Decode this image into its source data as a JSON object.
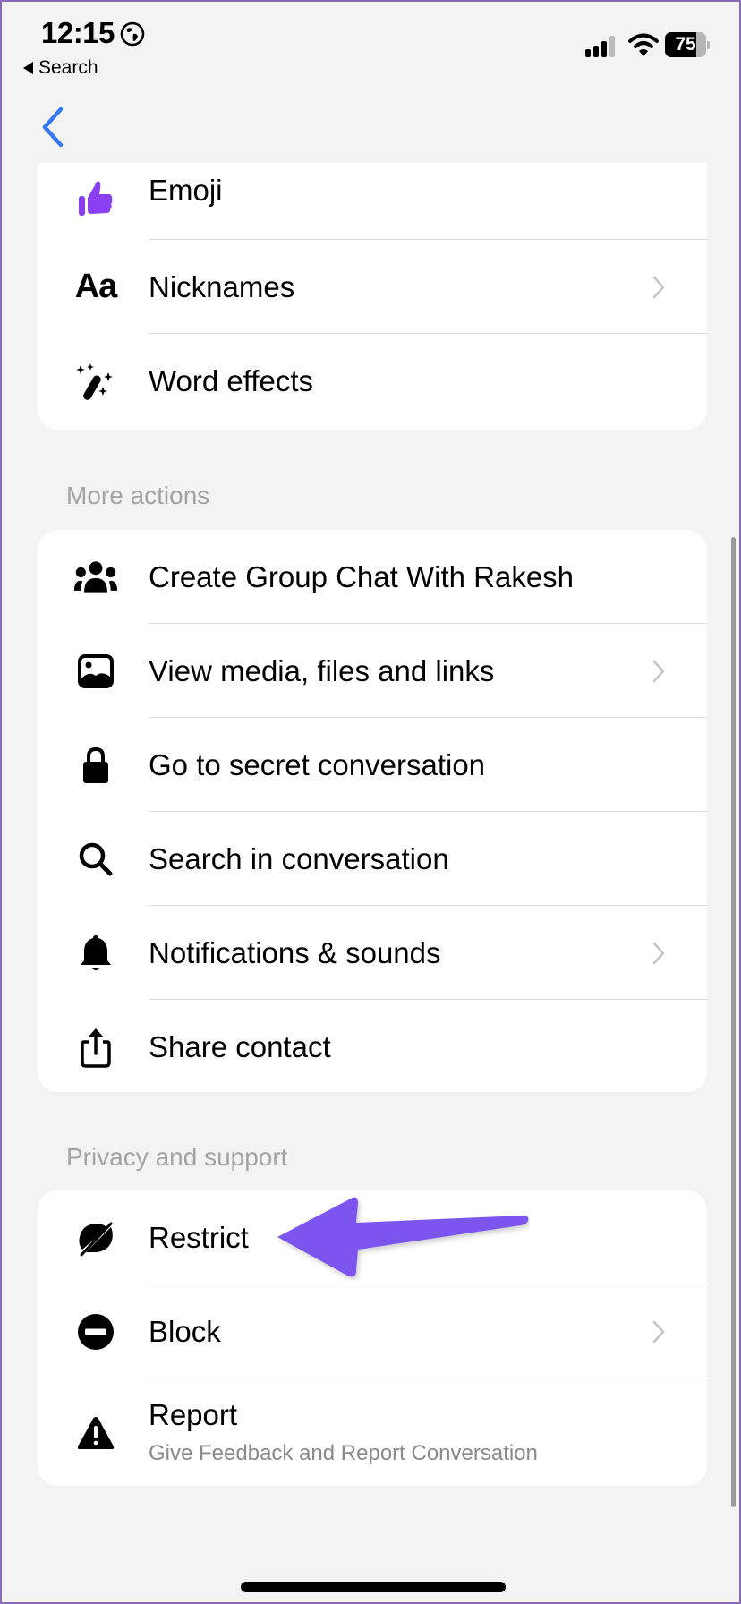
{
  "status_bar": {
    "time": "12:15",
    "back_app_label": "Search",
    "battery_percent": 75,
    "battery_label": "75",
    "signal_bars": 3,
    "icons": [
      "globe-icon",
      "signal-icon",
      "wifi-icon",
      "battery-icon"
    ]
  },
  "navigation": {
    "back_icon": "chevron-left-icon",
    "back_color": "#3478f6"
  },
  "customization_card": {
    "items": [
      {
        "label": "Emoji",
        "icon": "thumbs-up-icon",
        "icon_color": "#8a3ff2",
        "has_chevron": false
      },
      {
        "label": "Nicknames",
        "icon": "text-aa-icon",
        "has_chevron": true
      },
      {
        "label": "Word effects",
        "icon": "magic-wand-icon",
        "has_chevron": false
      }
    ]
  },
  "more_actions": {
    "title": "More actions",
    "items": [
      {
        "label": "Create Group Chat With Rakesh",
        "icon": "group-icon",
        "has_chevron": false
      },
      {
        "label": "View media, files and links",
        "icon": "image-icon",
        "has_chevron": true
      },
      {
        "label": "Go to secret conversation",
        "icon": "lock-icon",
        "has_chevron": false
      },
      {
        "label": "Search in conversation",
        "icon": "search-icon",
        "has_chevron": false
      },
      {
        "label": "Notifications & sounds",
        "icon": "bell-icon",
        "has_chevron": true
      },
      {
        "label": "Share contact",
        "icon": "share-icon",
        "has_chevron": false
      }
    ]
  },
  "privacy_support": {
    "title": "Privacy and support",
    "items": [
      {
        "label": "Restrict",
        "icon": "restrict-icon",
        "has_chevron": false
      },
      {
        "label": "Block",
        "icon": "block-icon",
        "has_chevron": true
      },
      {
        "label": "Report",
        "sublabel": "Give Feedback and Report Conversation",
        "icon": "warning-icon",
        "has_chevron": false
      }
    ]
  },
  "annotation": {
    "type": "arrow",
    "points_to": "Restrict",
    "color": "#7b55ef"
  }
}
